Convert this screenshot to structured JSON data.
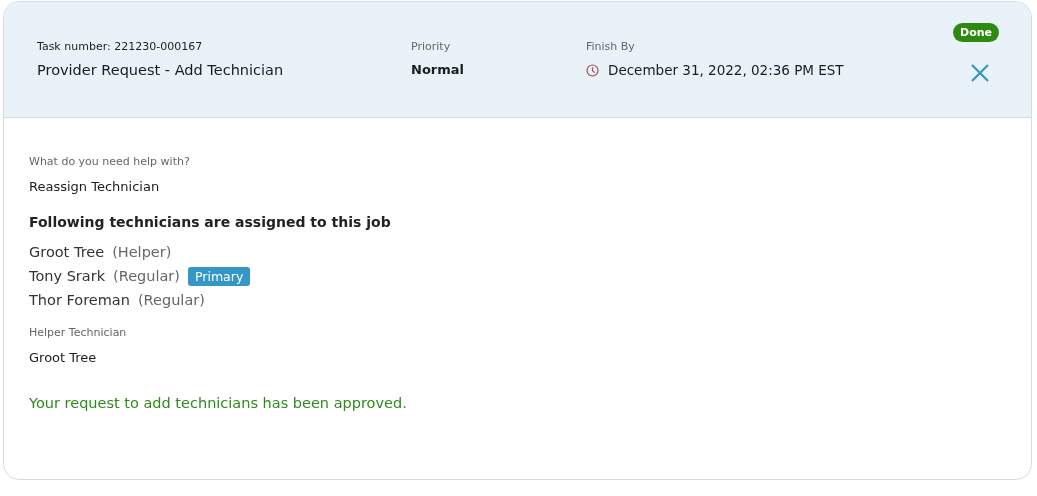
{
  "header": {
    "task_number": "Task number: 221230-000167",
    "title": "Provider Request - Add Technician",
    "priority_label": "Priority",
    "priority": "Normal",
    "finish_label": "Finish By",
    "finish": "December 31, 2022, 02:36 PM EST",
    "status": "Done"
  },
  "help_label": "What do you need help with?",
  "help_value": "Reassign Technician",
  "technicians_heading": "Following technicians are assigned to this job",
  "technicians": [
    {
      "name": "Groot Tree",
      "role": "(Helper)"
    },
    {
      "name": "Tony Srark",
      "role": "(Regular)",
      "badge": "Primary"
    },
    {
      "name": "Thor Foreman",
      "role": "(Regular)"
    }
  ],
  "helper_label": "Helper Technician",
  "helper_value": "Groot Tree",
  "message": "Your request to add technicians has been approved."
}
